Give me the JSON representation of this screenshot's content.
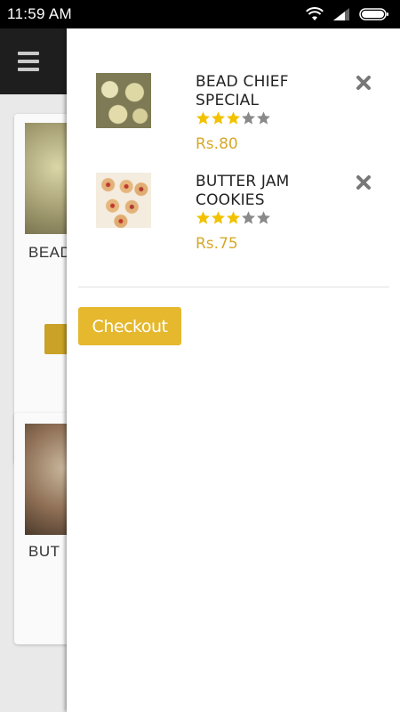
{
  "status_bar": {
    "time": "11:59  AM"
  },
  "background": {
    "cards": [
      {
        "title_fragment": "BEAD"
      },
      {
        "title_fragment": "BUT"
      }
    ]
  },
  "cart": {
    "items": [
      {
        "name": "BEAD CHIEF SPECIAL",
        "rating": 3,
        "max_rating": 5,
        "price": "Rs.80"
      },
      {
        "name": "BUTTER JAM COOKIES",
        "rating": 3,
        "max_rating": 5,
        "price": "Rs.75"
      }
    ],
    "checkout_label": "Checkout"
  },
  "colors": {
    "accent": "#e5b82e",
    "price": "#d6a82a",
    "star_filled": "#f2c200",
    "star_empty": "#8a8a8a"
  }
}
